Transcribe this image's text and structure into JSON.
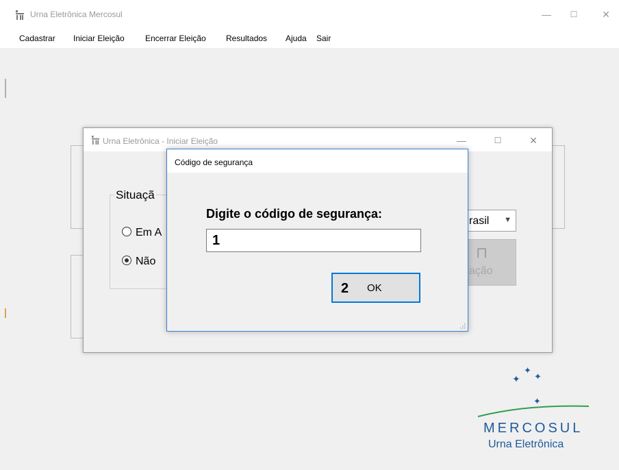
{
  "main_window": {
    "title": "Urna Eletrônica Mercosul",
    "controls": {
      "minimize": "—",
      "maximize": "☐",
      "close": "✕"
    }
  },
  "menu": {
    "items": [
      "Cadastrar",
      "Iniciar Eleição",
      "Encerrar Eleição",
      "Resultados",
      "Ajuda",
      "Sair"
    ]
  },
  "iniciar_dialog": {
    "title": "Urna Eletrônica - Iniciar Eleição",
    "controls": {
      "minimize": "—",
      "maximize": "☐",
      "close": "✕"
    },
    "group_label": "Situaçã",
    "radio_1": "Em A",
    "radio_2": "Não",
    "country_select": "rasil",
    "disabled_button_text": "ação"
  },
  "security_dialog": {
    "title": "Código de segurança",
    "prompt": "Digite o código de segurança:",
    "input_value": "1",
    "ok_number": "2",
    "ok_label": "OK"
  },
  "logo": {
    "word": "MERCOSUL",
    "subtitle": "Urna Eletrônica"
  },
  "colors": {
    "logo_blue": "#1f5a9a",
    "logo_green": "#2e9e4f",
    "focus_blue": "#0078d7"
  }
}
